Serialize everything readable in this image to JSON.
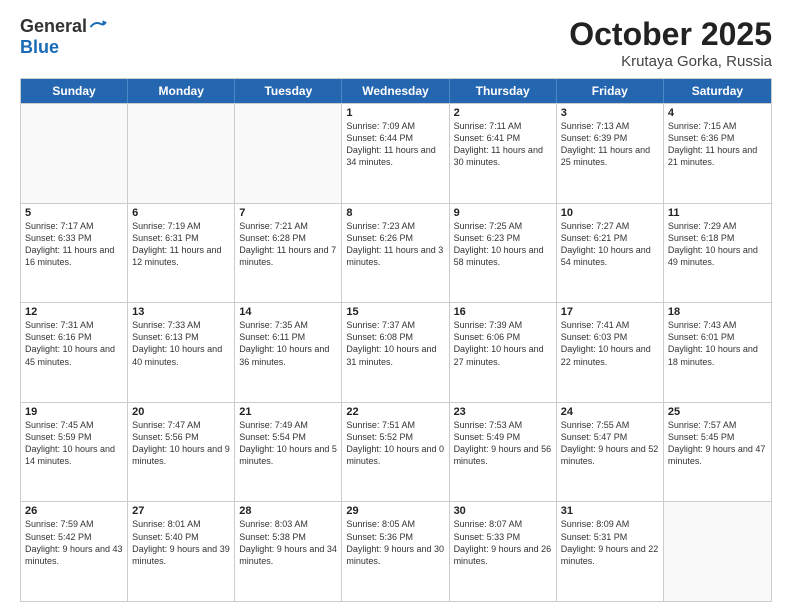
{
  "header": {
    "logo_general": "General",
    "logo_blue": "Blue",
    "month_title": "October 2025",
    "location": "Krutaya Gorka, Russia"
  },
  "day_headers": [
    "Sunday",
    "Monday",
    "Tuesday",
    "Wednesday",
    "Thursday",
    "Friday",
    "Saturday"
  ],
  "weeks": [
    [
      {
        "day": "",
        "sunrise": "",
        "sunset": "",
        "daylight": "",
        "empty": true
      },
      {
        "day": "",
        "sunrise": "",
        "sunset": "",
        "daylight": "",
        "empty": true
      },
      {
        "day": "",
        "sunrise": "",
        "sunset": "",
        "daylight": "",
        "empty": true
      },
      {
        "day": "1",
        "sunrise": "Sunrise: 7:09 AM",
        "sunset": "Sunset: 6:44 PM",
        "daylight": "Daylight: 11 hours and 34 minutes.",
        "empty": false
      },
      {
        "day": "2",
        "sunrise": "Sunrise: 7:11 AM",
        "sunset": "Sunset: 6:41 PM",
        "daylight": "Daylight: 11 hours and 30 minutes.",
        "empty": false
      },
      {
        "day": "3",
        "sunrise": "Sunrise: 7:13 AM",
        "sunset": "Sunset: 6:39 PM",
        "daylight": "Daylight: 11 hours and 25 minutes.",
        "empty": false
      },
      {
        "day": "4",
        "sunrise": "Sunrise: 7:15 AM",
        "sunset": "Sunset: 6:36 PM",
        "daylight": "Daylight: 11 hours and 21 minutes.",
        "empty": false
      }
    ],
    [
      {
        "day": "5",
        "sunrise": "Sunrise: 7:17 AM",
        "sunset": "Sunset: 6:33 PM",
        "daylight": "Daylight: 11 hours and 16 minutes.",
        "empty": false
      },
      {
        "day": "6",
        "sunrise": "Sunrise: 7:19 AM",
        "sunset": "Sunset: 6:31 PM",
        "daylight": "Daylight: 11 hours and 12 minutes.",
        "empty": false
      },
      {
        "day": "7",
        "sunrise": "Sunrise: 7:21 AM",
        "sunset": "Sunset: 6:28 PM",
        "daylight": "Daylight: 11 hours and 7 minutes.",
        "empty": false
      },
      {
        "day": "8",
        "sunrise": "Sunrise: 7:23 AM",
        "sunset": "Sunset: 6:26 PM",
        "daylight": "Daylight: 11 hours and 3 minutes.",
        "empty": false
      },
      {
        "day": "9",
        "sunrise": "Sunrise: 7:25 AM",
        "sunset": "Sunset: 6:23 PM",
        "daylight": "Daylight: 10 hours and 58 minutes.",
        "empty": false
      },
      {
        "day": "10",
        "sunrise": "Sunrise: 7:27 AM",
        "sunset": "Sunset: 6:21 PM",
        "daylight": "Daylight: 10 hours and 54 minutes.",
        "empty": false
      },
      {
        "day": "11",
        "sunrise": "Sunrise: 7:29 AM",
        "sunset": "Sunset: 6:18 PM",
        "daylight": "Daylight: 10 hours and 49 minutes.",
        "empty": false
      }
    ],
    [
      {
        "day": "12",
        "sunrise": "Sunrise: 7:31 AM",
        "sunset": "Sunset: 6:16 PM",
        "daylight": "Daylight: 10 hours and 45 minutes.",
        "empty": false
      },
      {
        "day": "13",
        "sunrise": "Sunrise: 7:33 AM",
        "sunset": "Sunset: 6:13 PM",
        "daylight": "Daylight: 10 hours and 40 minutes.",
        "empty": false
      },
      {
        "day": "14",
        "sunrise": "Sunrise: 7:35 AM",
        "sunset": "Sunset: 6:11 PM",
        "daylight": "Daylight: 10 hours and 36 minutes.",
        "empty": false
      },
      {
        "day": "15",
        "sunrise": "Sunrise: 7:37 AM",
        "sunset": "Sunset: 6:08 PM",
        "daylight": "Daylight: 10 hours and 31 minutes.",
        "empty": false
      },
      {
        "day": "16",
        "sunrise": "Sunrise: 7:39 AM",
        "sunset": "Sunset: 6:06 PM",
        "daylight": "Daylight: 10 hours and 27 minutes.",
        "empty": false
      },
      {
        "day": "17",
        "sunrise": "Sunrise: 7:41 AM",
        "sunset": "Sunset: 6:03 PM",
        "daylight": "Daylight: 10 hours and 22 minutes.",
        "empty": false
      },
      {
        "day": "18",
        "sunrise": "Sunrise: 7:43 AM",
        "sunset": "Sunset: 6:01 PM",
        "daylight": "Daylight: 10 hours and 18 minutes.",
        "empty": false
      }
    ],
    [
      {
        "day": "19",
        "sunrise": "Sunrise: 7:45 AM",
        "sunset": "Sunset: 5:59 PM",
        "daylight": "Daylight: 10 hours and 14 minutes.",
        "empty": false
      },
      {
        "day": "20",
        "sunrise": "Sunrise: 7:47 AM",
        "sunset": "Sunset: 5:56 PM",
        "daylight": "Daylight: 10 hours and 9 minutes.",
        "empty": false
      },
      {
        "day": "21",
        "sunrise": "Sunrise: 7:49 AM",
        "sunset": "Sunset: 5:54 PM",
        "daylight": "Daylight: 10 hours and 5 minutes.",
        "empty": false
      },
      {
        "day": "22",
        "sunrise": "Sunrise: 7:51 AM",
        "sunset": "Sunset: 5:52 PM",
        "daylight": "Daylight: 10 hours and 0 minutes.",
        "empty": false
      },
      {
        "day": "23",
        "sunrise": "Sunrise: 7:53 AM",
        "sunset": "Sunset: 5:49 PM",
        "daylight": "Daylight: 9 hours and 56 minutes.",
        "empty": false
      },
      {
        "day": "24",
        "sunrise": "Sunrise: 7:55 AM",
        "sunset": "Sunset: 5:47 PM",
        "daylight": "Daylight: 9 hours and 52 minutes.",
        "empty": false
      },
      {
        "day": "25",
        "sunrise": "Sunrise: 7:57 AM",
        "sunset": "Sunset: 5:45 PM",
        "daylight": "Daylight: 9 hours and 47 minutes.",
        "empty": false
      }
    ],
    [
      {
        "day": "26",
        "sunrise": "Sunrise: 7:59 AM",
        "sunset": "Sunset: 5:42 PM",
        "daylight": "Daylight: 9 hours and 43 minutes.",
        "empty": false
      },
      {
        "day": "27",
        "sunrise": "Sunrise: 8:01 AM",
        "sunset": "Sunset: 5:40 PM",
        "daylight": "Daylight: 9 hours and 39 minutes.",
        "empty": false
      },
      {
        "day": "28",
        "sunrise": "Sunrise: 8:03 AM",
        "sunset": "Sunset: 5:38 PM",
        "daylight": "Daylight: 9 hours and 34 minutes.",
        "empty": false
      },
      {
        "day": "29",
        "sunrise": "Sunrise: 8:05 AM",
        "sunset": "Sunset: 5:36 PM",
        "daylight": "Daylight: 9 hours and 30 minutes.",
        "empty": false
      },
      {
        "day": "30",
        "sunrise": "Sunrise: 8:07 AM",
        "sunset": "Sunset: 5:33 PM",
        "daylight": "Daylight: 9 hours and 26 minutes.",
        "empty": false
      },
      {
        "day": "31",
        "sunrise": "Sunrise: 8:09 AM",
        "sunset": "Sunset: 5:31 PM",
        "daylight": "Daylight: 9 hours and 22 minutes.",
        "empty": false
      },
      {
        "day": "",
        "sunrise": "",
        "sunset": "",
        "daylight": "",
        "empty": true
      }
    ]
  ]
}
